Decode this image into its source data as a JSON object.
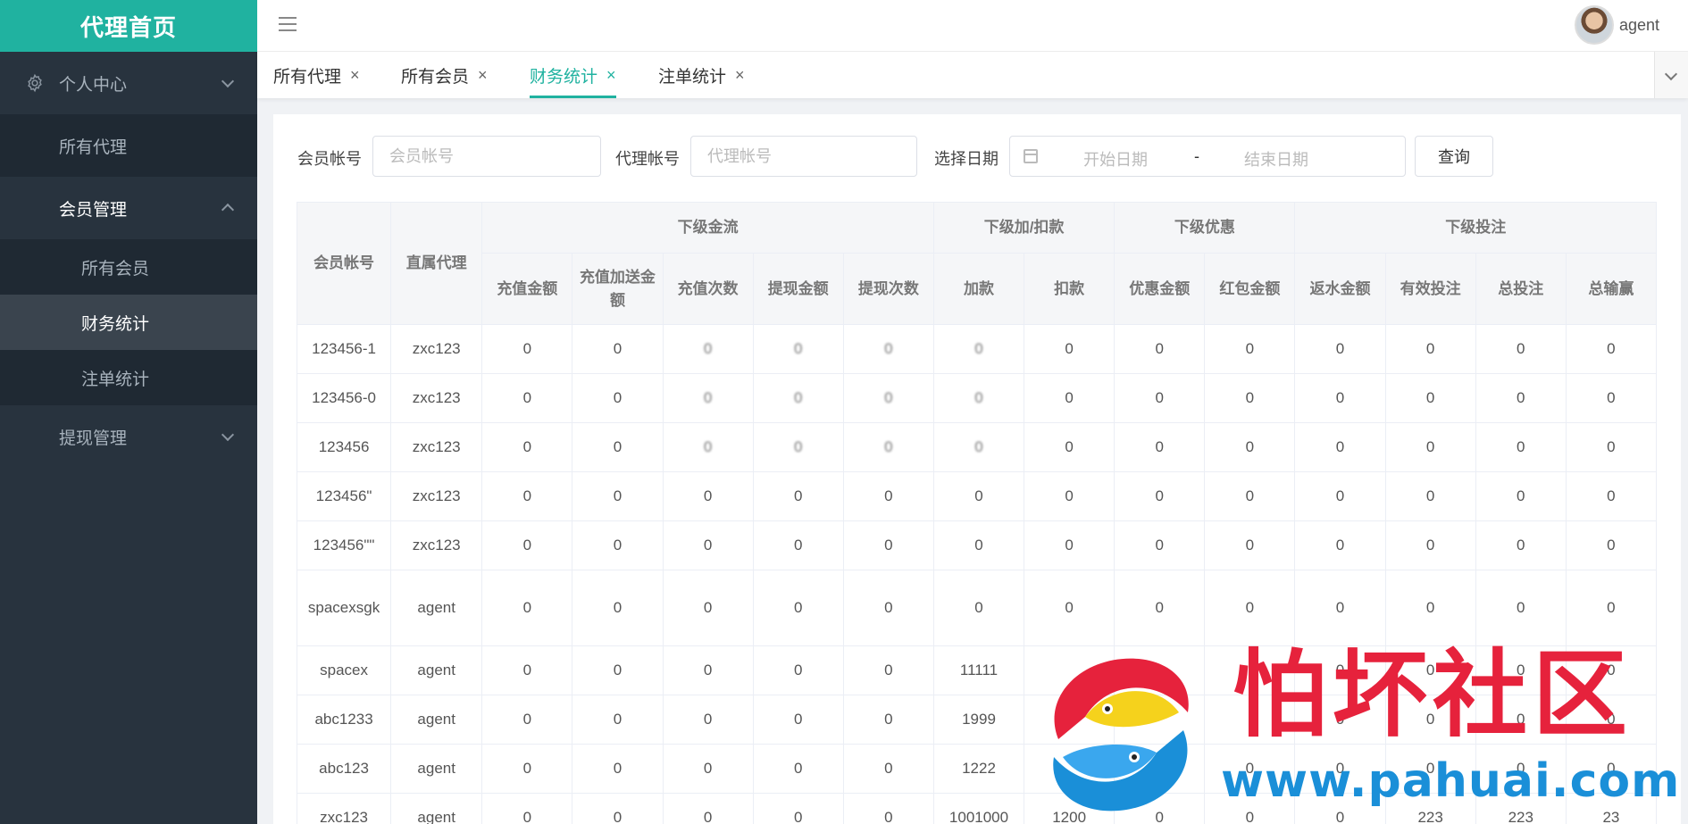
{
  "sidebar": {
    "logo": "代理首页",
    "items": [
      {
        "label": "个人中心"
      },
      {
        "label": "所有代理"
      },
      {
        "label": "会员管理"
      },
      {
        "label": "所有会员"
      },
      {
        "label": "财务统计"
      },
      {
        "label": "注单统计"
      },
      {
        "label": "提现管理"
      }
    ]
  },
  "header": {
    "user_name": "agent"
  },
  "tabs": [
    {
      "label": "所有代理"
    },
    {
      "label": "所有会员"
    },
    {
      "label": "财务统计"
    },
    {
      "label": "注单统计"
    }
  ],
  "tab_close": "×",
  "filter": {
    "member_label": "会员帐号",
    "member_placeholder": "会员帐号",
    "agent_label": "代理帐号",
    "agent_placeholder": "代理帐号",
    "date_label": "选择日期",
    "start_placeholder": "开始日期",
    "separator": "-",
    "end_placeholder": "结束日期",
    "query_label": "查询"
  },
  "table": {
    "group_headers": [
      "下级金流",
      "下级加/扣款",
      "下级优惠",
      "下级投注"
    ],
    "headers": [
      "会员帐号",
      "直属代理",
      "充值金额",
      "充值加送金额",
      "充值次数",
      "提现金额",
      "提现次数",
      "加款",
      "扣款",
      "优惠金额",
      "红包金额",
      "返水金额",
      "有效投注",
      "总投注",
      "总输赢"
    ],
    "rows": [
      [
        "123456-1",
        "zxc123",
        "0",
        "0",
        "0",
        "0",
        "0",
        "0",
        "0",
        "0",
        "0",
        "0",
        "0",
        "0",
        "0"
      ],
      [
        "123456-0",
        "zxc123",
        "0",
        "0",
        "0",
        "0",
        "0",
        "0",
        "0",
        "0",
        "0",
        "0",
        "0",
        "0",
        "0"
      ],
      [
        "123456",
        "zxc123",
        "0",
        "0",
        "0",
        "0",
        "0",
        "0",
        "0",
        "0",
        "0",
        "0",
        "0",
        "0",
        "0"
      ],
      [
        "123456\"",
        "zxc123",
        "0",
        "0",
        "0",
        "0",
        "0",
        "0",
        "0",
        "0",
        "0",
        "0",
        "0",
        "0",
        "0"
      ],
      [
        "123456\"\"",
        "zxc123",
        "0",
        "0",
        "0",
        "0",
        "0",
        "0",
        "0",
        "0",
        "0",
        "0",
        "0",
        "0",
        "0"
      ],
      [
        "spacexsgk",
        "agent",
        "0",
        "0",
        "0",
        "0",
        "0",
        "0",
        "0",
        "0",
        "0",
        "0",
        "0",
        "0",
        "0"
      ],
      [
        "spacex",
        "agent",
        "0",
        "0",
        "0",
        "0",
        "0",
        "11111",
        "",
        "",
        "",
        "0",
        "0",
        "0",
        "0"
      ],
      [
        "abc1233",
        "agent",
        "0",
        "0",
        "0",
        "0",
        "0",
        "1999",
        "",
        "",
        "",
        "0",
        "0",
        "0",
        "0"
      ],
      [
        "abc123",
        "agent",
        "0",
        "0",
        "0",
        "0",
        "0",
        "1222",
        "",
        "",
        "0",
        "0",
        "0",
        "0",
        "0"
      ],
      [
        "zxc123",
        "agent",
        "0",
        "0",
        "0",
        "0",
        "0",
        "1001000",
        "1200",
        "0",
        "0",
        "0",
        "223",
        "223",
        "23"
      ]
    ]
  },
  "watermark": {
    "title": "怕坏社区",
    "url": "www.pahuai.com"
  },
  "colors": {
    "accent": "#20b2a0",
    "sidebar_bg": "#28333e",
    "watermark_red": "#e6223c",
    "watermark_blue": "#1a8fd8"
  }
}
